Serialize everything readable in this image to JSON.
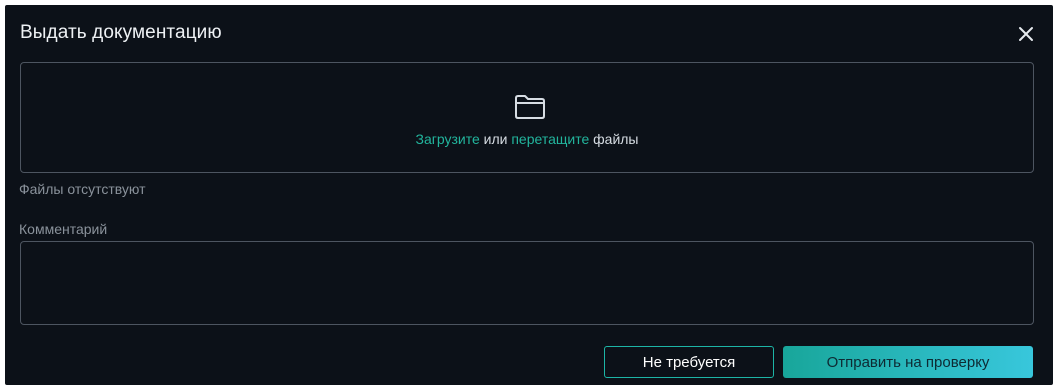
{
  "dialog": {
    "title": "Выдать документацию",
    "close_icon": "close-icon"
  },
  "upload": {
    "folder_icon": "folder-icon",
    "link_upload": "Загрузите",
    "text_or": " или ",
    "link_drag": "перетащите",
    "text_files": " файлы",
    "status": "Файлы отсутствуют"
  },
  "comment": {
    "label": "Комментарий",
    "value": "",
    "placeholder": ""
  },
  "buttons": {
    "not_required": "Не требуется",
    "submit": "Отправить на проверку"
  },
  "colors": {
    "background": "#0c1118",
    "accent": "#22b59d",
    "border": "#4d5560",
    "gradient_start": "#18a69a",
    "gradient_end": "#38c7dc"
  }
}
